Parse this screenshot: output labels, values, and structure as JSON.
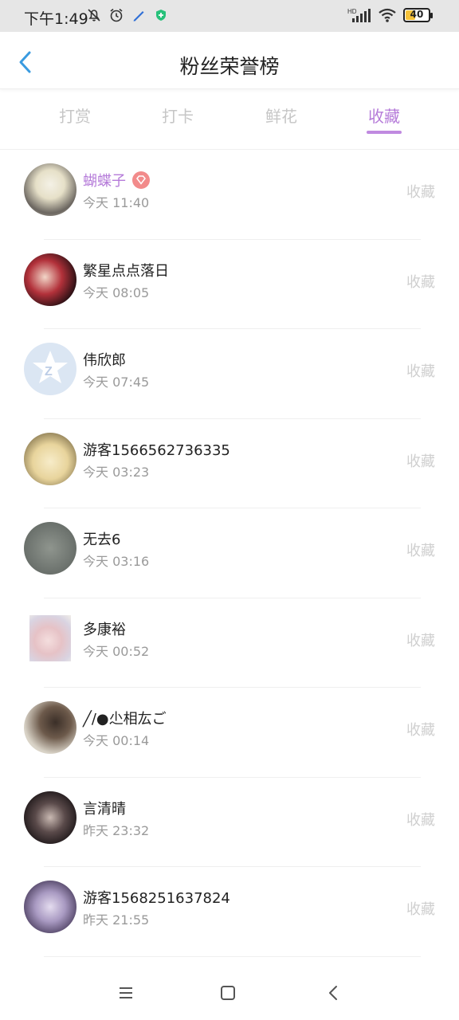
{
  "status_bar": {
    "time": "下午1:49",
    "battery": "40",
    "battery_level": 0.4,
    "network_label": "HD"
  },
  "header": {
    "title": "粉丝荣誉榜"
  },
  "tabs": [
    {
      "label": "打赏"
    },
    {
      "label": "打卡"
    },
    {
      "label": "鲜花"
    },
    {
      "label": "收藏"
    }
  ],
  "active_tab": "收藏",
  "list": [
    {
      "name": "蝴蝶子",
      "time": "今天 11:40",
      "action": "收藏",
      "vip": true
    },
    {
      "name": "繁星点点落日",
      "time": "今天 08:05",
      "action": "收藏"
    },
    {
      "name": "伟欣郎",
      "time": "今天 07:45",
      "action": "收藏"
    },
    {
      "name": "游客1566562736335",
      "time": "今天 03:23",
      "action": "收藏"
    },
    {
      "name": "无去6",
      "time": "今天 03:16",
      "action": "收藏"
    },
    {
      "name": "多康裕",
      "time": "今天 00:52",
      "action": "收藏"
    },
    {
      "name": "╱/●尐相厷ご",
      "time": "今天 00:14",
      "action": "收藏"
    },
    {
      "name": "言清晴",
      "time": "昨天 23:32",
      "action": "收藏"
    },
    {
      "name": "游客1568251637824",
      "time": "昨天 21:55",
      "action": "收藏"
    }
  ],
  "colors": {
    "accent": "#b57bd9",
    "vip_badge": "#f28b8b",
    "back_arrow": "#3a9be0"
  }
}
